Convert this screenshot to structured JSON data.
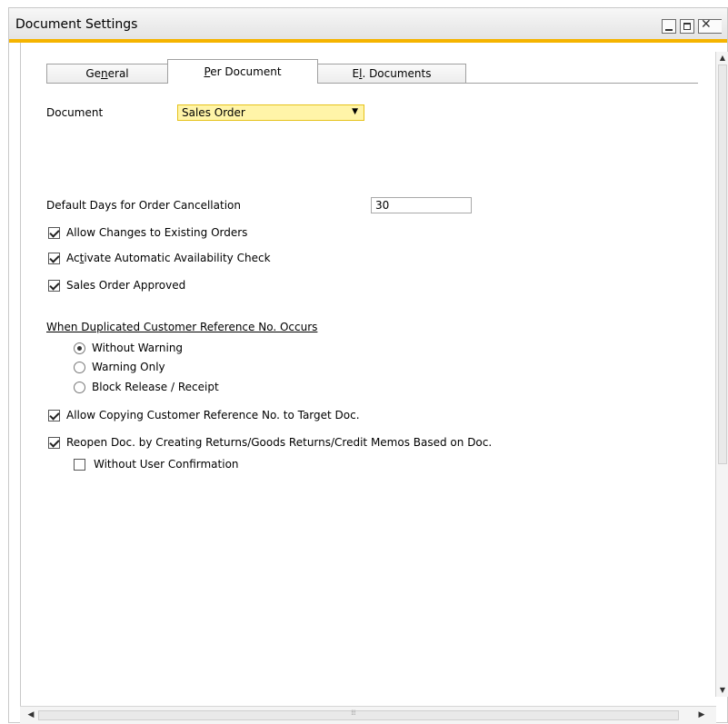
{
  "window": {
    "title": "Document Settings"
  },
  "tabs": [
    {
      "label_pre": "Ge",
      "label_key": "n",
      "label_post": "eral",
      "active": false
    },
    {
      "label_pre": "",
      "label_key": "P",
      "label_post": "er Document",
      "active": true
    },
    {
      "label_pre": "E",
      "label_key": "l",
      "label_post": ". Documents",
      "active": false
    }
  ],
  "document": {
    "label": "Document",
    "value": "Sales Order"
  },
  "cancellation": {
    "label": "Default Days for Order Cancellation",
    "value": "30"
  },
  "options": {
    "allow_changes": {
      "label": "Allow Changes to Existing Orders",
      "checked": true
    },
    "availability_check": {
      "label_pre": "Ac",
      "label_key": "t",
      "label_post": "ivate Automatic Availability Check",
      "checked": true
    },
    "sales_order_approved": {
      "label": "Sales Order Approved",
      "checked": true
    }
  },
  "duplicated_ref": {
    "heading": "When Duplicated Customer Reference No. Occurs",
    "radios": [
      {
        "label": "Without Warning",
        "selected": true
      },
      {
        "label": "Warning Only",
        "selected": false
      },
      {
        "label": "Block Release / Receipt",
        "selected": false
      }
    ]
  },
  "copy_ref": {
    "label": "Allow Copying Customer Reference No. to Target Doc.",
    "checked": true
  },
  "reopen_doc": {
    "label": "Reopen Doc. by Creating Returns/Goods Returns/Credit Memos Based on Doc.",
    "checked": true
  },
  "without_confirmation": {
    "label": "Without User Confirmation",
    "checked": false
  },
  "icons": {
    "minimize": "minimize-icon",
    "maximize": "maximize-icon",
    "close": "close-icon",
    "dropdown": "dropdown-arrow-icon"
  },
  "colors": {
    "accent": "#f5b400",
    "field_highlight": "#fff4a8"
  }
}
